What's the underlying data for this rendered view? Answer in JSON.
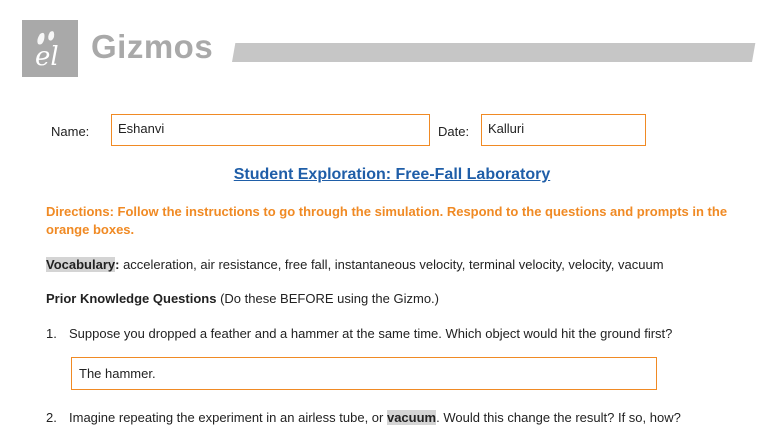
{
  "header": {
    "brand": "Gizmos",
    "logo_letters": "el"
  },
  "form": {
    "name_label": "Name:",
    "name_value": "Eshanvi",
    "date_label": "Date:",
    "date_value": "Kalluri"
  },
  "title": "Student Exploration: Free-Fall Laboratory",
  "directions": "Directions: Follow the instructions to go through the simulation. Respond to the questions and prompts in the orange boxes.",
  "vocabulary": {
    "label": "Vocabulary",
    "colon": ":",
    "terms": " acceleration, air resistance, free fall, instantaneous velocity, terminal velocity, velocity, vacuum"
  },
  "prior_knowledge": {
    "heading": "Prior Knowledge Questions",
    "note": " (Do these BEFORE using the Gizmo.)"
  },
  "questions": [
    {
      "number": "1.",
      "text": "Suppose you dropped a feather and a hammer at the same time. Which object would hit the ground first?",
      "answer": "The hammer."
    },
    {
      "number": "2.",
      "text_before": "Imagine repeating the experiment in an airless tube, or ",
      "highlight": "vacuum",
      "text_after": ". Would this change the result? If so, how?"
    }
  ],
  "colors": {
    "accent_orange": "#f08a24",
    "title_blue": "#1f5ea8",
    "logo_gray": "#a9a9a9"
  }
}
